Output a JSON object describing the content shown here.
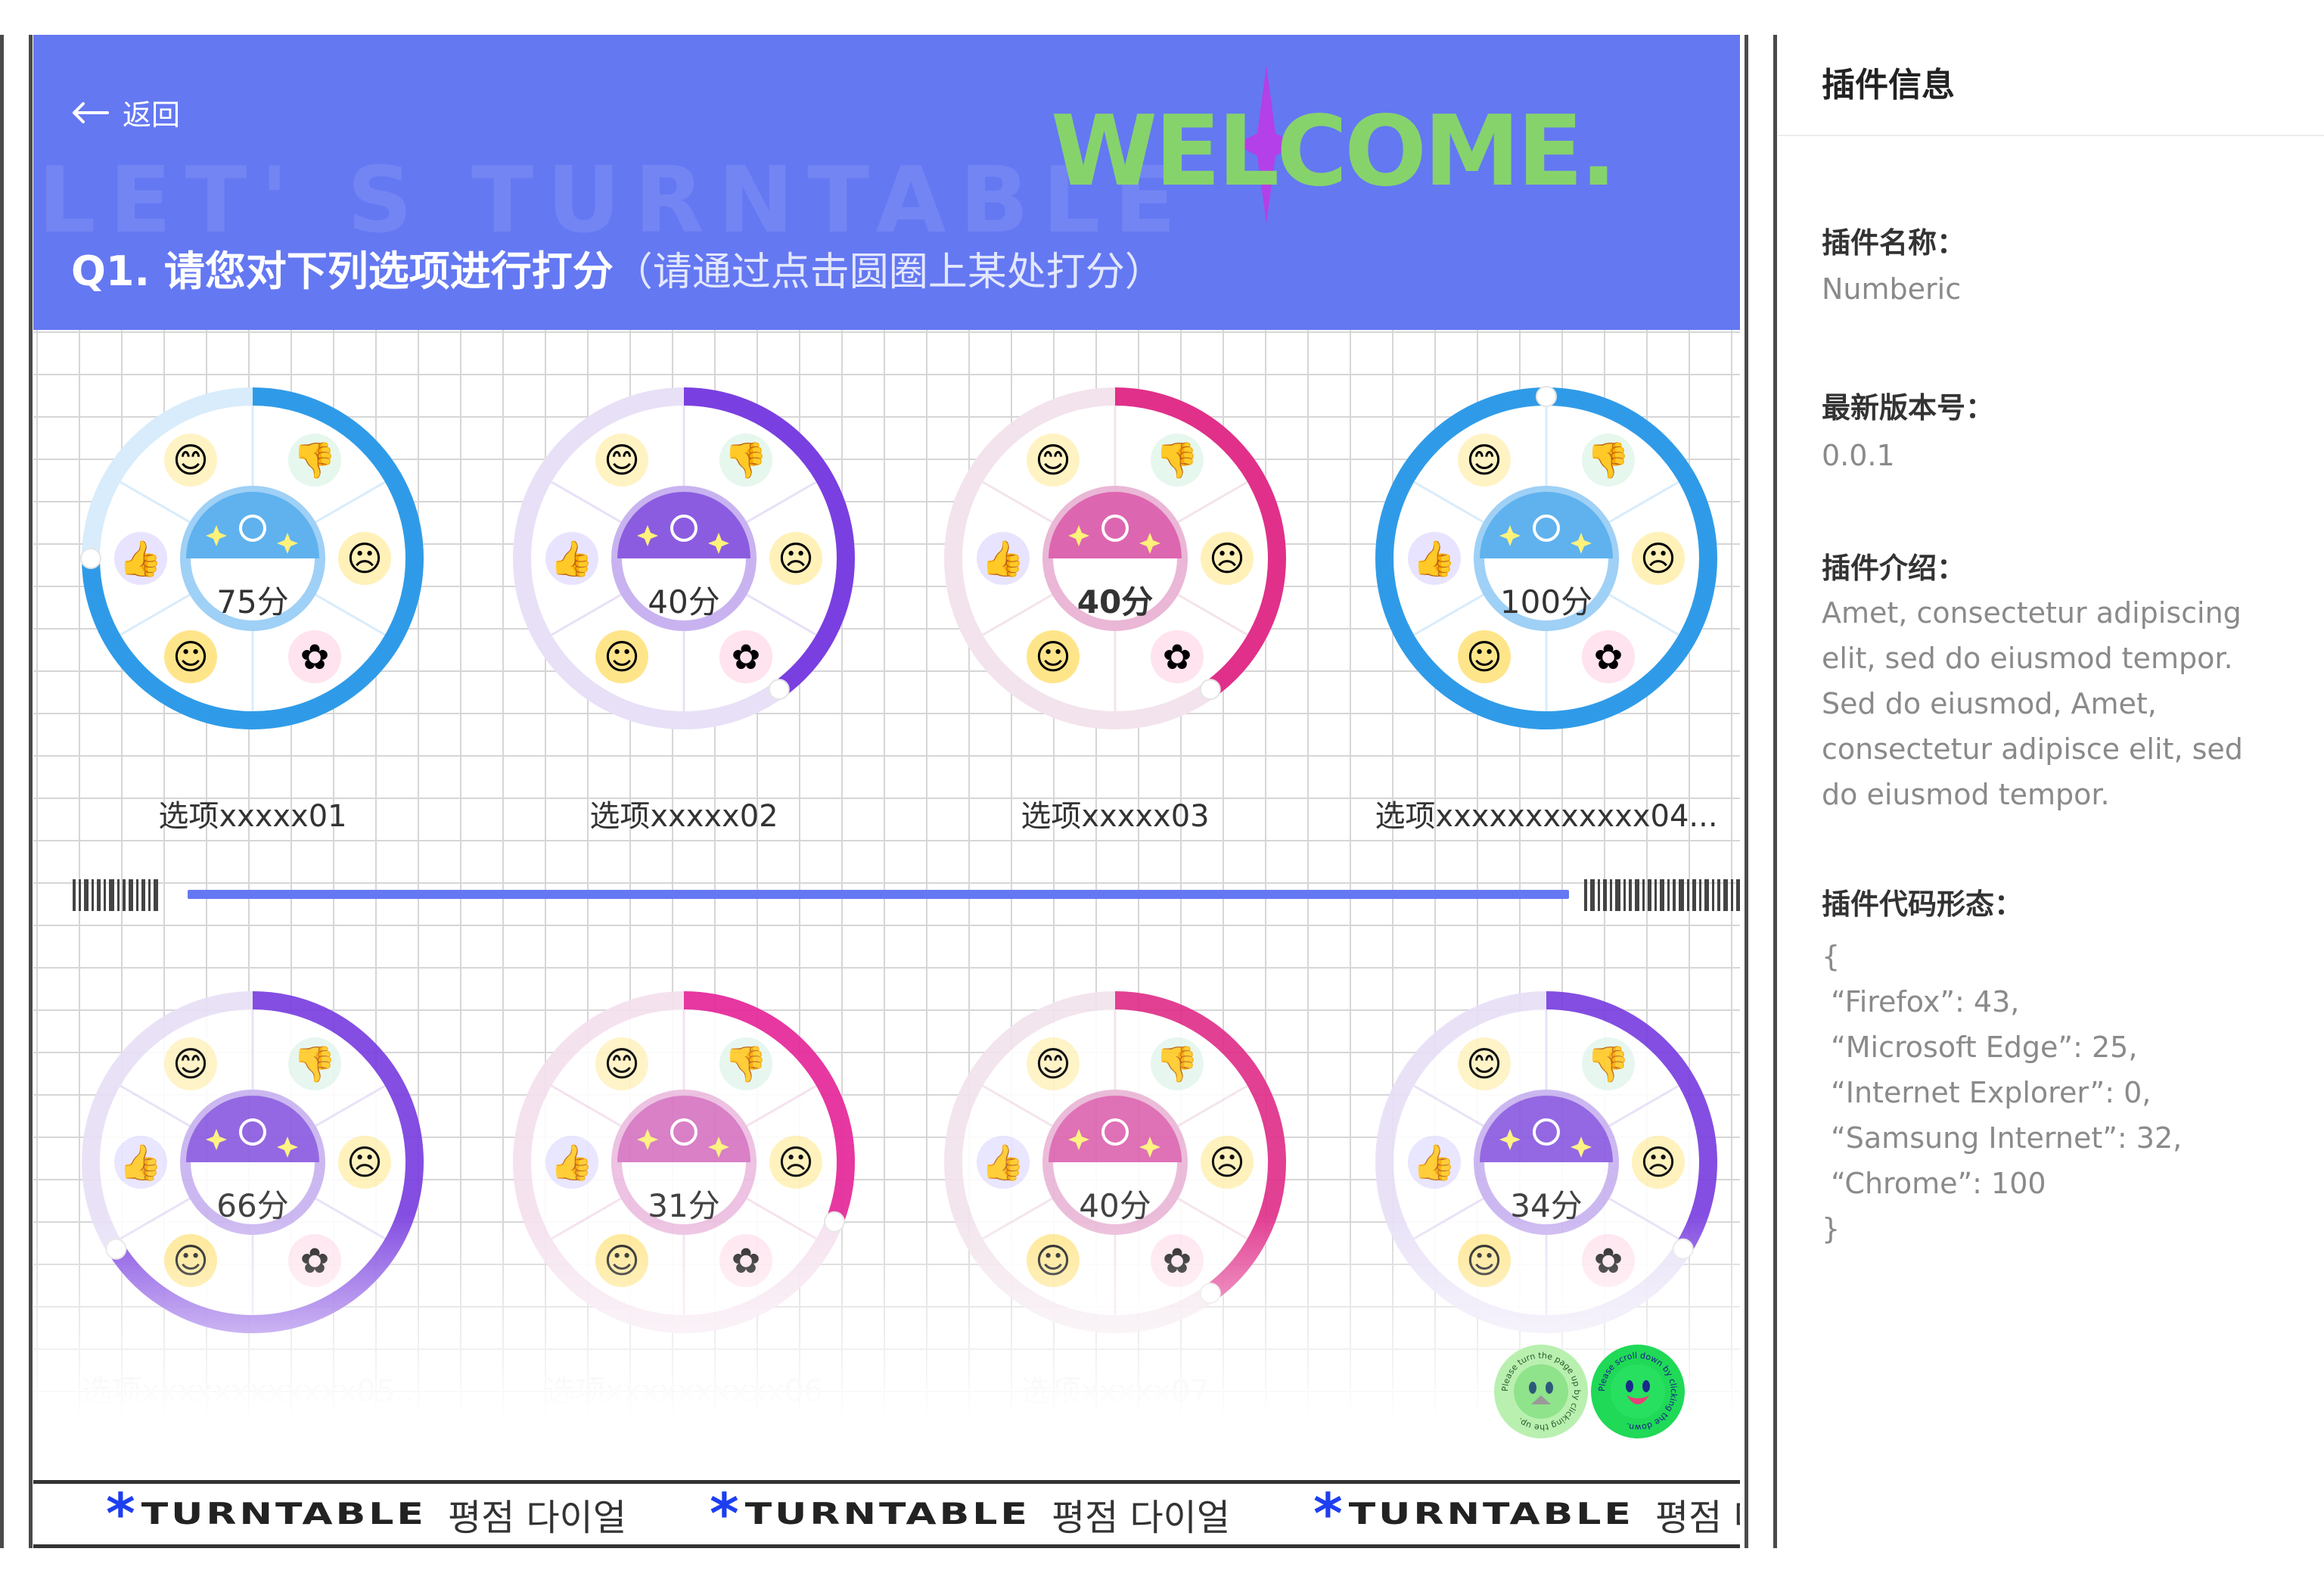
{
  "header": {
    "back_label": "返回",
    "ghost_text": "LET' S TURNTABLE",
    "welcome_text": "WELCOME.",
    "question_main": "Q1. 请您对下列选项进行打分",
    "question_hint": "（请通过点击圆圈上某处打分）"
  },
  "dials": [
    {
      "label": "选项xxxxx01",
      "score_text": "75分",
      "score": 75,
      "theme": "blue"
    },
    {
      "label": "选项xxxxx02",
      "score_text": "40分",
      "score": 40,
      "theme": "purple"
    },
    {
      "label": "选项xxxxx03",
      "score_text": "40分",
      "score": 40,
      "theme": "pink"
    },
    {
      "label": "选项xxxxxxxxxxxx04...",
      "score_text": "100分",
      "score": 100,
      "theme": "blue"
    },
    {
      "label": "选项xxxxxxxxxxxx05...",
      "score_text": "66分",
      "score": 66,
      "theme": "purple"
    },
    {
      "label": "选项xxxxxxxxxx06",
      "score_text": "31分",
      "score": 31,
      "theme": "magenta"
    },
    {
      "label": "选项xxxxx07",
      "score_text": "40分",
      "score": 40,
      "theme": "pink"
    },
    {
      "label": "",
      "score_text": "34分",
      "score": 34,
      "theme": "purple"
    }
  ],
  "themes": {
    "blue": {
      "ring": "#2f9be8",
      "track": "#d8ecfb",
      "face_top": "#5fb2ee",
      "face_ring": "#9fd0f6"
    },
    "purple": {
      "ring": "#7a3fe0",
      "track": "#e8e0f7",
      "face_top": "#8b5ce0",
      "face_ring": "#c8b3f0"
    },
    "pink": {
      "ring": "#e0308a",
      "track": "#f3e3ec",
      "face_top": "#dd66b0",
      "face_ring": "#eab7d6"
    },
    "magenta": {
      "ring": "#e6279a",
      "track": "#f5e0ee",
      "face_top": "#d676c2",
      "face_ring": "#ecbde0"
    }
  },
  "emojis": [
    "heart-face-icon",
    "thumbs-down-icon",
    "sad-face-icon",
    "flower-icon",
    "smile-face-icon",
    "thumbs-up-icon"
  ],
  "stickers": {
    "up_text": "Please turn the page up by clicking the up.",
    "down_text": "Please scroll down by clicking the down."
  },
  "marquee": {
    "word": "TURNTABLE",
    "korean": "평점 다이얼"
  },
  "panel": {
    "title": "插件信息",
    "name_label": "插件名称：",
    "name_value": "Numberic",
    "version_label": "最新版本号：",
    "version_value": "0.0.1",
    "intro_label": "插件介绍：",
    "intro_value": "Amet, consectetur adipiscing elit, sed do eiusmod tempor. Sed do eiusmod, Amet, consectetur adipisce elit, sed do eiusmod tempor.",
    "code_label": "插件代码形态：",
    "code_lines": [
      "{",
      " “Firefox”: 43,",
      " “Microsoft Edge”: 25,",
      " “Internet Explorer”: 0,",
      " “Samsung Internet”: 32,",
      " “Chrome”: 100",
      "}"
    ]
  }
}
